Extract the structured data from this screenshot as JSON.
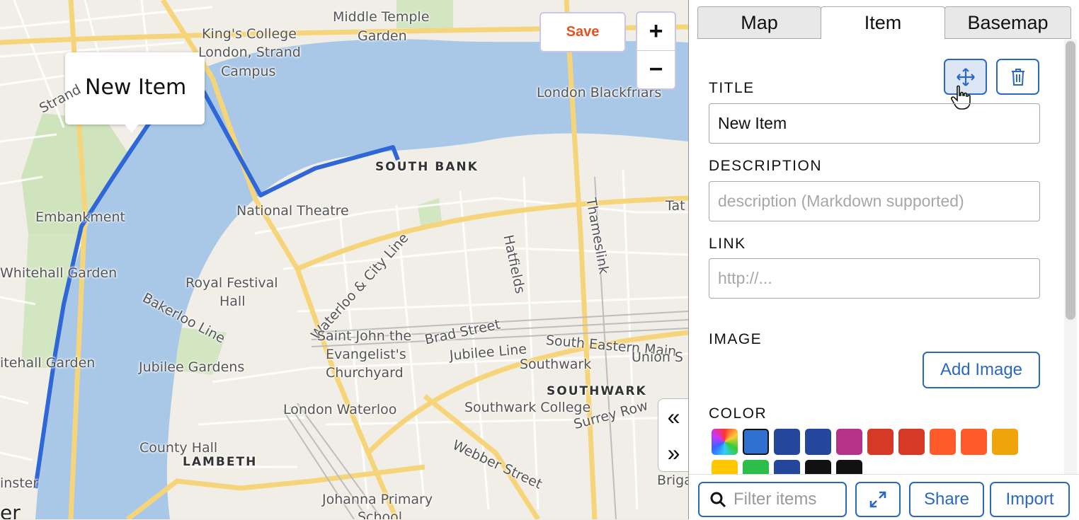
{
  "map": {
    "callout_title": "New Item",
    "labels": {
      "middle_temple": "Middle Temple",
      "garden1": "Garden",
      "kings1": "King's College",
      "kings2": "London, Strand",
      "kings3": "Campus",
      "strand": "Strand",
      "blackfriars": "London Blackfriars",
      "south_bank": "SOUTH BANK",
      "embankment": "Embankment",
      "national_theatre": "National Theatre",
      "whitehall1": "Whitehall Garden",
      "whitehall2": "itehall Garden",
      "royal1": "Royal Festival",
      "royal2": "Hall",
      "bakerloo": "Bakerloo Line",
      "waterloo_city": "Waterloo & City Line",
      "hatfields": "Hatfields",
      "thameslink": "Thameslink",
      "tate": "Tat",
      "saint1": "Saint John the",
      "saint2": "Evangelist's",
      "saint3": "Churchyard",
      "brad": "Brad Street",
      "jubilee_line": "Jubilee Line",
      "jubilee_gardens": "Jubilee Gardens",
      "se_main": "South Eastern Main",
      "union": "Union S",
      "southwark": "Southwark",
      "southwark_caps": "SOUTHWARK",
      "waterloo": "London Waterloo",
      "southwark_college": "Southwark College",
      "surrey_row": "Surrey Row",
      "county_hall": "County Hall",
      "lambeth": "LAMBETH",
      "webber": "Webber Street",
      "inster": "inster",
      "johanna1": "Johanna Primary",
      "johanna2": "School",
      "er": "er",
      "briga": "Briga"
    },
    "save_label": "Save",
    "zoom_in": "+",
    "zoom_out": "−",
    "collapse_left": "«",
    "collapse_right": "»"
  },
  "panel": {
    "tabs": [
      "Map",
      "Item",
      "Basemap"
    ],
    "active_tab": "Item",
    "title_label": "TITLE",
    "title_value": "New Item",
    "description_label": "DESCRIPTION",
    "description_placeholder": "description (Markdown supported)",
    "link_label": "LINK",
    "link_placeholder": "http://...",
    "image_label": "IMAGE",
    "add_image": "Add Image",
    "color_label": "COLOR",
    "colors_row1": [
      "rainbow",
      "#3070d0",
      "#24479b",
      "#24479b",
      "#b43388",
      "#d63a27",
      "#d63a27",
      "#ff5a2a",
      "#ff5a2a",
      "#f0a30a"
    ],
    "colors_row2": [
      "#ffc800",
      "#2bbe4a",
      "#24479b",
      "#111111",
      "#111111"
    ],
    "selected_color": "#3070d0"
  },
  "footer": {
    "filter_placeholder": "Filter items",
    "share": "Share",
    "import": "Import"
  }
}
